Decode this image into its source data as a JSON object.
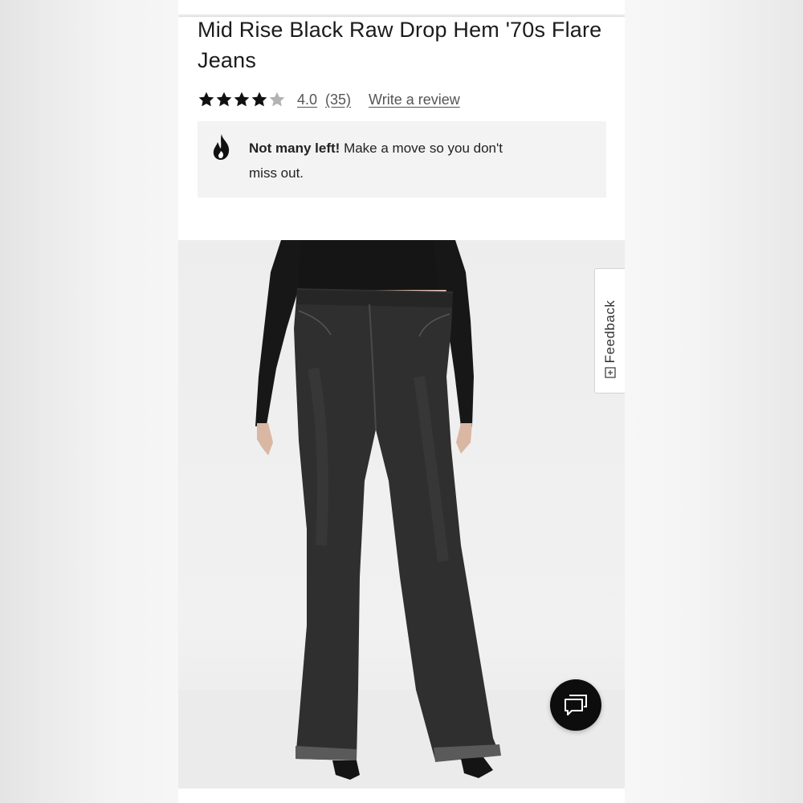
{
  "product": {
    "title": "Mid Rise Black Raw Drop Hem '70s Flare Jeans"
  },
  "rating": {
    "stars_filled": 4,
    "stars_total": 5,
    "value": "4.0",
    "count": "(35)",
    "write_review_label": "Write a review"
  },
  "alert": {
    "icon": "flame-icon",
    "bold": "Not many left!",
    "text": " Make a move so you don't miss out."
  },
  "feedback_tab": {
    "label": "Feedback",
    "icon": "plus-box-icon"
  },
  "chat": {
    "icon": "chat-bubbles-icon"
  },
  "colors": {
    "text": "#1b1b1b",
    "alert_bg": "#f3f3f3",
    "chat_bg": "#0d0d0d",
    "denim": "#2f2f2f"
  }
}
